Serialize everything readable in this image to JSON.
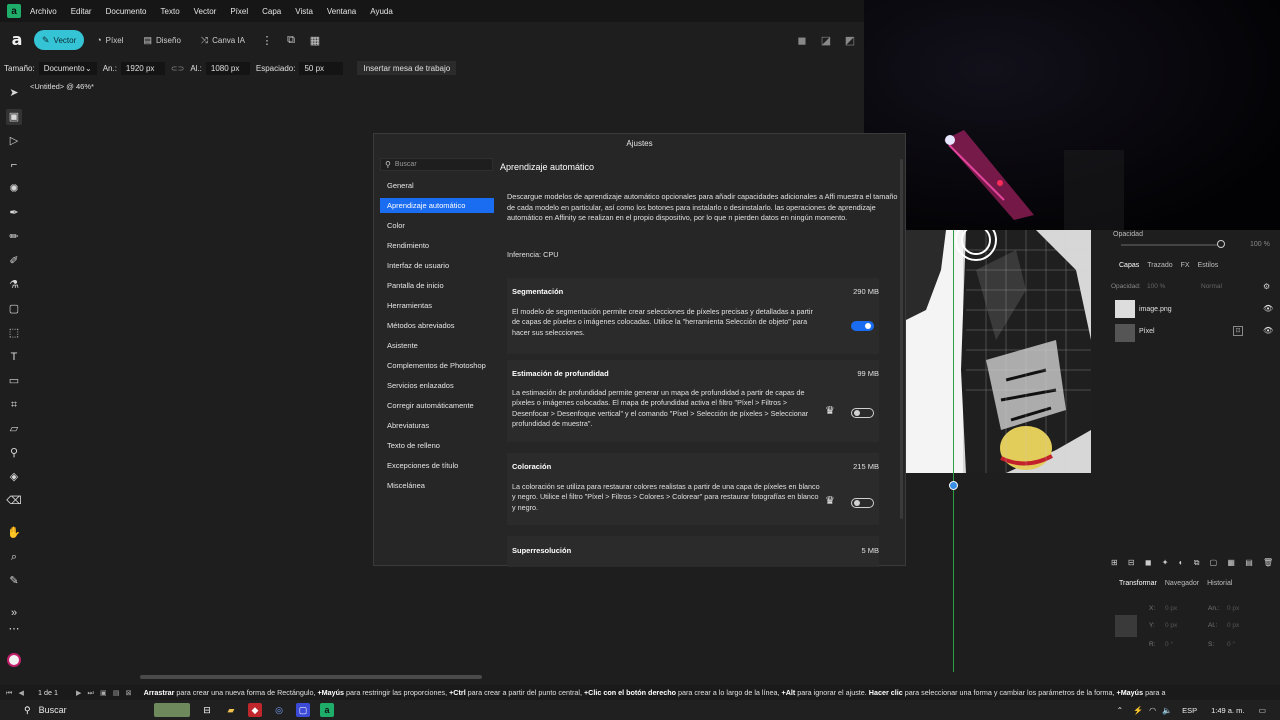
{
  "menu": [
    "Archivo",
    "Editar",
    "Documento",
    "Texto",
    "Vector",
    "Píxel",
    "Capa",
    "Vista",
    "Ventana",
    "Ayuda"
  ],
  "toolbar": {
    "personas": [
      {
        "label": "Vector",
        "icon": "vector-persona-icon",
        "active": true
      },
      {
        "label": "Píxel",
        "icon": "pixel-persona-icon",
        "active": false
      },
      {
        "label": "Diseño",
        "icon": "layout-persona-icon",
        "active": false
      },
      {
        "label": "Canva IA",
        "icon": "canva-ai-icon",
        "active": false
      }
    ]
  },
  "context": {
    "size_label": "Tamaño:",
    "size_value": "Documento",
    "width_label": "An.:",
    "width_value": "1920 px",
    "height_label": "Al.:",
    "height_value": "1080 px",
    "spacing_label": "Espaciado:",
    "spacing_value": "50 px",
    "insert_button": "Insertar mesa de trabajo"
  },
  "doc_tab": "<Untitled> @ 46%*",
  "dialog": {
    "title": "Ajustes",
    "search_placeholder": "Buscar",
    "nav": [
      "General",
      "Aprendizaje automático",
      "Color",
      "Rendimiento",
      "Interfaz de usuario",
      "Pantalla de inicio",
      "Herramientas",
      "Métodos abreviados",
      "Asistente",
      "Complementos de Photoshop",
      "Servicios enlazados",
      "Corregir automáticamente",
      "Abreviaturas",
      "Texto de relleno",
      "Excepciones de título",
      "Miscelánea"
    ],
    "active_nav": "Aprendizaje automático",
    "section_title": "Aprendizaje automático",
    "intro": "Descargue modelos de aprendizaje automático opcionales para añadir capacidades adicionales a Affi muestra el tamaño de cada modelo en particular, así como los botones para instalarlo o desinstalarlo. las operaciones de aprendizaje automático en Affinity se realizan en el propio dispositivo, por lo que n pierden datos en ningún momento.",
    "inference": "Inferencia: CPU",
    "models": [
      {
        "name": "Segmentación",
        "size": "290 MB",
        "description": "El modelo de segmentación permite crear selecciones de píxeles precisas y detalladas a partir de capas de píxeles o imágenes colocadas. Utilice la \"herramienta Selección de objeto\" para hacer sus selecciones.",
        "enabled": true,
        "premium": false
      },
      {
        "name": "Estimación de profundidad",
        "size": "99 MB",
        "description": "La estimación de profundidad permite generar un mapa de profundidad a partir de capas de píxeles o imágenes colocadas. El mapa de profundidad activa el filtro \"Píxel > Filtros > Desenfocar > Desenfoque vertical\" y el comando \"Píxel > Selección de píxeles > Seleccionar profundidad de muestra\".",
        "enabled": false,
        "premium": true
      },
      {
        "name": "Coloración",
        "size": "215 MB",
        "description": "La coloración se utiliza para restaurar colores realistas a partir de una capa de píxeles en blanco y negro. Utilice el filtro \"Píxel > Filtros > Colores > Colorear\" para restaurar fotografías en blanco y negro.",
        "enabled": false,
        "premium": true
      },
      {
        "name": "Superresolución",
        "size": "5 MB",
        "description": "",
        "enabled": false,
        "premium": false
      }
    ]
  },
  "right_panel": {
    "opacity_label": "Opacidad",
    "opacity_value": "100 %",
    "layer_tabs": [
      "Capas",
      "Trazado",
      "FX",
      "Estilos"
    ],
    "layer_opacity_label": "Opacidad:",
    "layer_opacity_value": "100 %",
    "blend_mode": "Normal",
    "layers": [
      "image.png",
      "Píxel"
    ],
    "transform_tabs": [
      "Transformar",
      "Navegador",
      "Historial"
    ],
    "transform": {
      "x_label": "X:",
      "x_value": "0 px",
      "y_label": "Y:",
      "y_value": "0 px",
      "w_label": "An.:",
      "w_value": "0 px",
      "h_label": "Al.:",
      "h_value": "0 px",
      "r_label": "R:",
      "r_value": "0 °",
      "s_label": "S:",
      "s_value": "0 °"
    }
  },
  "status": {
    "page": "1 de 1",
    "hint_parts": [
      {
        "b": "Arrastrar",
        "t": " para crear una nueva forma de Rectángulo, "
      },
      {
        "b": "+Mayús",
        "t": " para restringir las proporciones, "
      },
      {
        "b": "+Ctrl",
        "t": " para crear a partir del punto central, "
      },
      {
        "b": "+Clic con el botón derecho",
        "t": " para crear a lo largo de la línea, "
      },
      {
        "b": "+Alt",
        "t": " para ignorar el ajuste. "
      },
      {
        "b": "Hacer clic",
        "t": " para seleccionar una forma y cambiar los parámetros de la forma, "
      },
      {
        "b": "+Mayús",
        "t": " para a"
      }
    ]
  },
  "taskbar": {
    "search": "Buscar",
    "lang": "ESP",
    "time": "1:49 a. m."
  },
  "colors": {
    "accent": "#1a6cf0",
    "persona_active": "#35c3d6",
    "guide": "#2ea043"
  }
}
